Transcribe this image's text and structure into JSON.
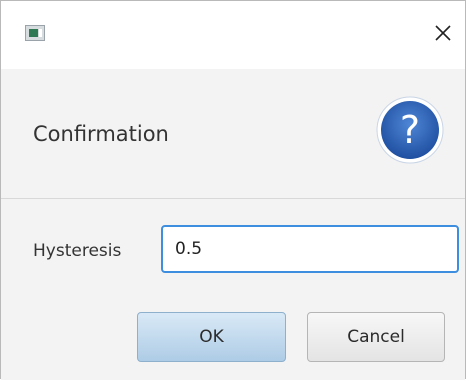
{
  "window": {
    "close_glyph": "✕"
  },
  "header": {
    "title": "Confirmation",
    "icon": "question-mark-icon",
    "icon_glyph": "?",
    "icon_color": "#2a62b8"
  },
  "form": {
    "label": "Hysteresis",
    "value": "0.5"
  },
  "buttons": {
    "ok_label": "OK",
    "cancel_label": "Cancel"
  },
  "colors": {
    "focus_border": "#3d8edf",
    "ok_button": "#c4dcf0",
    "panel_background": "#f3f3f3"
  }
}
